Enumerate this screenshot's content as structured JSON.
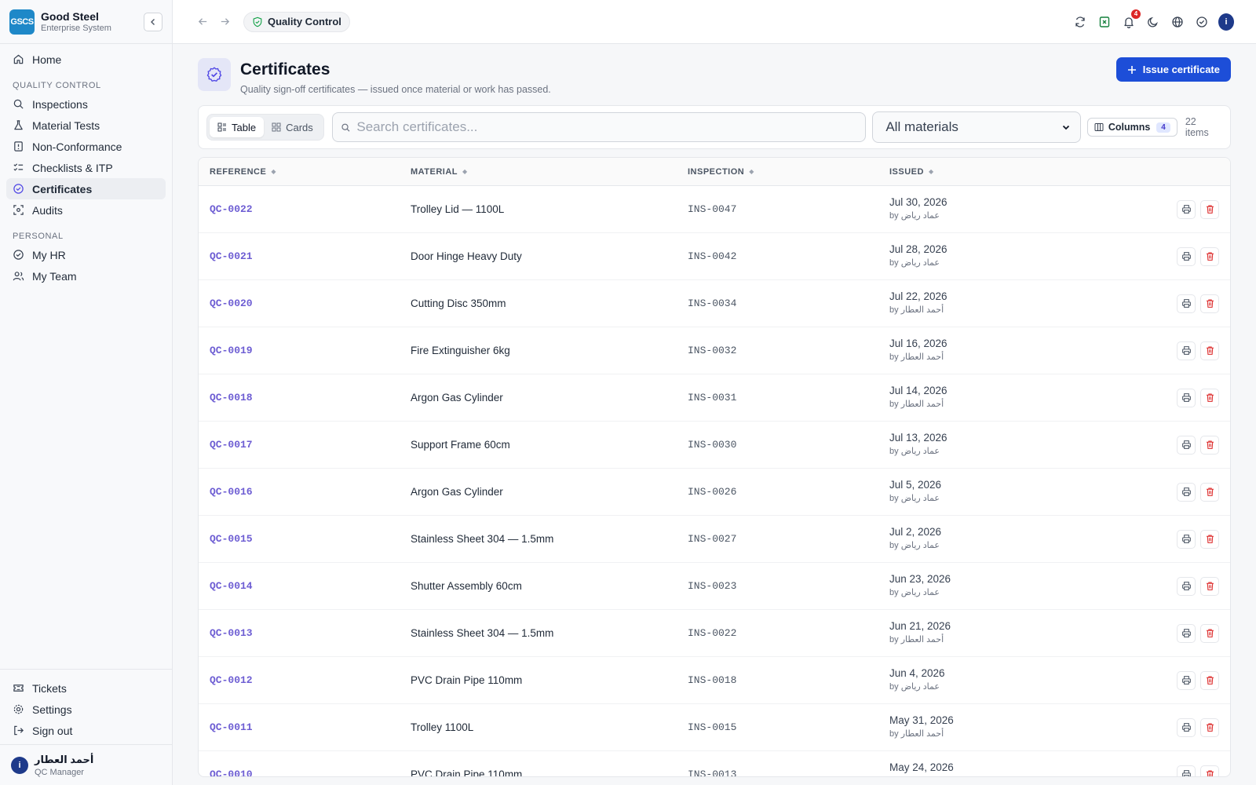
{
  "brand": {
    "logo_text": "GSCS",
    "name": "Good Steel",
    "subtitle": "Enterprise System"
  },
  "sidebar": {
    "home": "Home",
    "sections": [
      {
        "title": "QUALITY CONTROL",
        "items": [
          {
            "label": "Inspections",
            "icon": "search-icon"
          },
          {
            "label": "Material Tests",
            "icon": "flask-icon"
          },
          {
            "label": "Non-Conformance",
            "icon": "alert-file-icon"
          },
          {
            "label": "Checklists & ITP",
            "icon": "checklist-icon"
          },
          {
            "label": "Certificates",
            "icon": "check-circle-icon",
            "active": true
          },
          {
            "label": "Audits",
            "icon": "scan-icon"
          }
        ]
      },
      {
        "title": "PERSONAL",
        "items": [
          {
            "label": "My HR",
            "icon": "check-circle-icon"
          },
          {
            "label": "My Team",
            "icon": "users-icon"
          }
        ]
      }
    ],
    "bottom": [
      {
        "label": "Tickets",
        "icon": "ticket-icon"
      },
      {
        "label": "Settings",
        "icon": "gear-icon"
      },
      {
        "label": "Sign out",
        "icon": "sign-out-icon"
      }
    ],
    "user": {
      "initial": "i",
      "name": "أحمد العطار",
      "role": "QC Manager"
    }
  },
  "topbar": {
    "breadcrumb": "Quality Control",
    "notification_count": "4",
    "avatar_initial": "i"
  },
  "page": {
    "title": "Certificates",
    "subtitle": "Quality sign-off certificates — issued once material or work has passed.",
    "primary_action": "Issue certificate"
  },
  "toolbar": {
    "view_table": "Table",
    "view_cards": "Cards",
    "search_placeholder": "Search certificates...",
    "material_filter": "All materials",
    "columns_label": "Columns",
    "columns_count": "4",
    "item_count": "22 items"
  },
  "table": {
    "headers": {
      "reference": "REFERENCE",
      "material": "MATERIAL",
      "inspection": "INSPECTION",
      "issued": "ISSUED"
    },
    "rows": [
      {
        "ref": "QC-0022",
        "material": "Trolley Lid — 1100L",
        "inspection": "INS-0047",
        "date": "Jul 30, 2026",
        "by": "by عماد رياض"
      },
      {
        "ref": "QC-0021",
        "material": "Door Hinge Heavy Duty",
        "inspection": "INS-0042",
        "date": "Jul 28, 2026",
        "by": "by عماد رياض"
      },
      {
        "ref": "QC-0020",
        "material": "Cutting Disc 350mm",
        "inspection": "INS-0034",
        "date": "Jul 22, 2026",
        "by": "by أحمد العطار"
      },
      {
        "ref": "QC-0019",
        "material": "Fire Extinguisher 6kg",
        "inspection": "INS-0032",
        "date": "Jul 16, 2026",
        "by": "by أحمد العطار"
      },
      {
        "ref": "QC-0018",
        "material": "Argon Gas Cylinder",
        "inspection": "INS-0031",
        "date": "Jul 14, 2026",
        "by": "by أحمد العطار"
      },
      {
        "ref": "QC-0017",
        "material": "Support Frame 60cm",
        "inspection": "INS-0030",
        "date": "Jul 13, 2026",
        "by": "by عماد رياض"
      },
      {
        "ref": "QC-0016",
        "material": "Argon Gas Cylinder",
        "inspection": "INS-0026",
        "date": "Jul 5, 2026",
        "by": "by عماد رياض"
      },
      {
        "ref": "QC-0015",
        "material": "Stainless Sheet 304 — 1.5mm",
        "inspection": "INS-0027",
        "date": "Jul 2, 2026",
        "by": "by عماد رياض"
      },
      {
        "ref": "QC-0014",
        "material": "Shutter Assembly 60cm",
        "inspection": "INS-0023",
        "date": "Jun 23, 2026",
        "by": "by عماد رياض"
      },
      {
        "ref": "QC-0013",
        "material": "Stainless Sheet 304 — 1.5mm",
        "inspection": "INS-0022",
        "date": "Jun 21, 2026",
        "by": "by أحمد العطار"
      },
      {
        "ref": "QC-0012",
        "material": "PVC Drain Pipe 110mm",
        "inspection": "INS-0018",
        "date": "Jun 4, 2026",
        "by": "by عماد رياض"
      },
      {
        "ref": "QC-0011",
        "material": "Trolley 1100L",
        "inspection": "INS-0015",
        "date": "May 31, 2026",
        "by": "by أحمد العطار"
      },
      {
        "ref": "QC-0010",
        "material": "PVC Drain Pipe 110mm",
        "inspection": "INS-0013",
        "date": "May 24, 2026",
        "by": ""
      }
    ]
  },
  "colors": {
    "accent": "#1d4ed8",
    "ref_text": "#6d5dd3",
    "delete": "#dc2626",
    "logo_bg": "#1e88c8"
  }
}
